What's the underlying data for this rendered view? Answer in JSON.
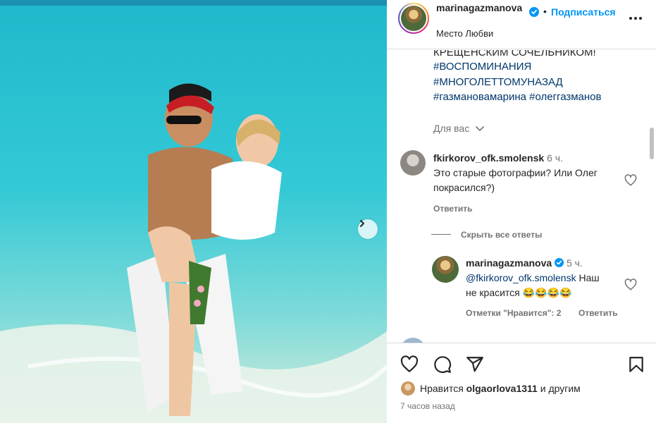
{
  "post": {
    "username": "marinagazmanova",
    "follow_label": "Подписаться",
    "dot": "•",
    "location": "Место Любви"
  },
  "caption": {
    "cut_line": "КРЕЩЕНСКИМ СОЧЕЛЬНИКОМ!",
    "hashtag_1": "#ВОСПОМИНАНИЯ",
    "hashtag_2": "#МНОГОЛЕТТОМУНАЗАД",
    "hashtag_3": "#газмановамарина #олеггазманов",
    "for_you": "Для вас"
  },
  "comments": [
    {
      "username": "fkirkorov_ofk.smolensk",
      "time": "6 ч.",
      "text_line_1": "Это старые фотографии? Или Олег",
      "text_line_2": "покрасился?)",
      "reply_label": "Ответить"
    }
  ],
  "replies": {
    "hide_label": "Скрыть все ответы",
    "items": [
      {
        "username": "marinagazmanova",
        "time": "5 ч.",
        "mention": "@fkirkorov_ofk.smolensk",
        "text_after": " Наш",
        "text_line_2": "не красится 😂😂😂😂",
        "likes_label": "Отметки \"Нравится\": 2",
        "reply_label": "Ответить"
      }
    ]
  },
  "footer": {
    "liked_prefix": "Нравится ",
    "liked_user": "olgaorlova1311",
    "liked_suffix": " и другим",
    "time_ago": "7 часов назад"
  },
  "icons": [
    "heart-icon",
    "comment-icon",
    "share-icon",
    "bookmark-icon",
    "more-icon",
    "verified-icon",
    "chevron-down-icon",
    "chevron-right-icon"
  ],
  "colors": {
    "accent": "#0095f6",
    "link": "#00376b",
    "muted": "#737373",
    "verified": "#0095f6"
  }
}
